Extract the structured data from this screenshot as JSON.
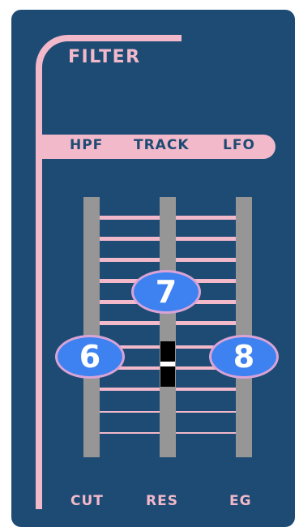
{
  "panel": {
    "title": "FILTER",
    "mode_labels": [
      "HPF",
      "TRACK",
      "LFO"
    ],
    "control_labels": [
      "CUT",
      "RES",
      "EG"
    ],
    "badges": [
      "6",
      "7",
      "8"
    ]
  },
  "colors": {
    "panel_bg": "#1e4b73",
    "accent_pink": "#f2b9cb",
    "rail_gray": "#969696",
    "badge_blue": "#3d82f0",
    "badge_border": "#d9a3d6"
  }
}
